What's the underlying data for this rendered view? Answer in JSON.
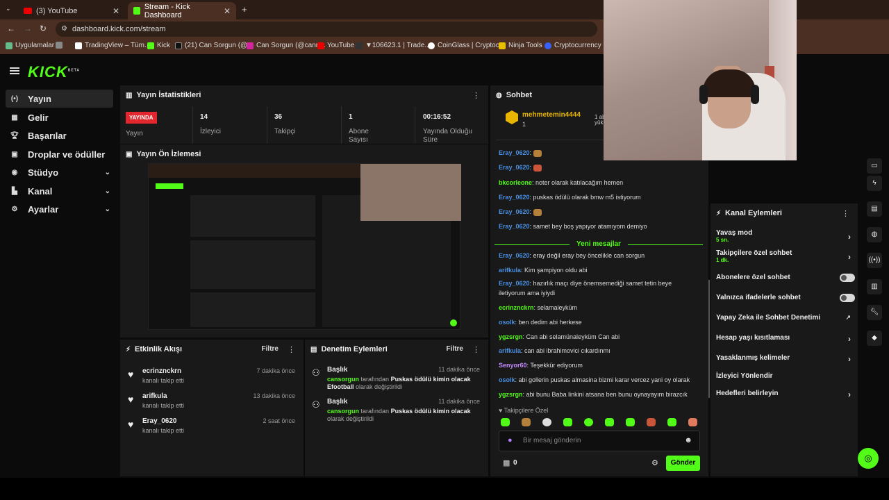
{
  "browser": {
    "tabs": [
      {
        "label": "(3) YouTube"
      },
      {
        "label": "Stream - Kick Dashboard"
      }
    ],
    "new_tab": "+",
    "url": "dashboard.kick.com/stream",
    "bookmarks": [
      "Uygulamalar",
      "TradingView – Tüm...",
      "Kick",
      "(21) Can Sorgun (@...",
      "Can Sorgun (@cann...",
      "YouTube",
      "▼106623.1 | Trade...",
      "CoinGlass | Cryptoc...",
      "Ninja Tools",
      "Cryptocurrency Pric..."
    ]
  },
  "app": {
    "logo": "KICK",
    "logo_badge": "BETA",
    "nav": [
      {
        "label": "Yayın",
        "icon": "stream-icon"
      },
      {
        "label": "Gelir",
        "icon": "revenue-icon"
      },
      {
        "label": "Başarılar",
        "icon": "trophy-icon"
      },
      {
        "label": "Droplar ve ödüller",
        "icon": "gift-icon"
      },
      {
        "label": "Stüdyo",
        "icon": "studio-icon"
      },
      {
        "label": "Kanal",
        "icon": "channel-icon"
      },
      {
        "label": "Ayarlar",
        "icon": "gear-icon"
      }
    ]
  },
  "stats": {
    "title": "Yayın İstatistikleri",
    "live_badge": "YAYINDA",
    "live_label": "Yayın",
    "items": [
      {
        "value": "14",
        "label": "İzleyici"
      },
      {
        "value": "36",
        "label": "Takipçi"
      },
      {
        "value": "1",
        "label": "Abone Sayısı"
      },
      {
        "value": "00:16:52",
        "label": "Yayında Olduğu Süre"
      }
    ]
  },
  "preview": {
    "title": "Yayın Ön İzlemesi"
  },
  "events": {
    "title": "Etkinlik Akışı",
    "filter": "Filtre",
    "items": [
      {
        "name": "ecrinznckrn",
        "sub": "kanalı takip etti",
        "time": "7 dakika önce"
      },
      {
        "name": "arifkula",
        "sub": "kanalı takip etti",
        "time": "13 dakika önce"
      },
      {
        "name": "Eray_0620",
        "sub": "kanalı takip etti",
        "time": "2 saat önce"
      }
    ]
  },
  "moderation": {
    "title": "Denetim Eylemleri",
    "filter": "Filtre",
    "items": [
      {
        "title": "Başlık",
        "time": "11 dakika önce",
        "actor": "cansorgun",
        "mid": " tarafından ",
        "target": "Puskas ödülü kimin olacak Efootball",
        "suffix": " olarak değiştirildi"
      },
      {
        "title": "Başlık",
        "time": "11 dakika önce",
        "actor": "cansorgun",
        "mid": " tarafından ",
        "target": "Puskas ödülü kimin olacak",
        "suffix": " olarak değiştirildi"
      }
    ]
  },
  "chat": {
    "title": "Sohbet",
    "pinned_user": "mehmetemin4444",
    "pinned_count": "1",
    "pinned_extra": "1 ab yük",
    "new_messages": "Yeni mesajlar",
    "messages": [
      {
        "user": "Eray_0620",
        "color": "#4a90e2",
        "text": ": "
      },
      {
        "user": "Eray_0620",
        "color": "#4a90e2",
        "text": ": "
      },
      {
        "user": "bkcorleone",
        "color": "#53fc18",
        "text": ": noter olarak katılacağım hemen"
      },
      {
        "user": "Eray_0620",
        "color": "#4a90e2",
        "text": ": puskas ödülü olarak bmw m5 istiyorum"
      },
      {
        "user": "Eray_0620",
        "color": "#4a90e2",
        "text": ": "
      },
      {
        "user": "Eray_0620",
        "color": "#4a90e2",
        "text": ": samet bey boş yapıyor atamıyom demiyo"
      },
      {
        "user": "Eray_0620",
        "color": "#4a90e2",
        "text": ": eray değil eray bey öncelikle can sorgun"
      },
      {
        "user": "arifkula",
        "color": "#4a90e2",
        "text": ": Kim şampiyon oldu abi"
      },
      {
        "user": "Eray_0620",
        "color": "#4a90e2",
        "text": ": hazırlık maçı diye önemsemediği samet tetin beye iletiyorum ama iyiydi"
      },
      {
        "user": "ecrinznckrn",
        "color": "#53fc18",
        "text": ": selamaleyküm"
      },
      {
        "user": "osolk",
        "color": "#4a90e2",
        "text": ": ben dedim abi herkese"
      },
      {
        "user": "ygzsrgn",
        "color": "#53fc18",
        "text": ": Can abi selamünaleyküm Can abi"
      },
      {
        "user": "arifkula",
        "color": "#4a90e2",
        "text": ": can abi ibrahimovici cıkardınmı"
      },
      {
        "user": "Senyor60",
        "color": "#c48bff",
        "text": ": Teşekkür ediyorum"
      },
      {
        "user": "osolk",
        "color": "#4a90e2",
        "text": ": abi gollerin puskas almasina bizmi karar vercez yani oy olarak"
      },
      {
        "user": "ygzsrgn",
        "color": "#53fc18",
        "text": ": abi bunu Baba linkini atsana ben bunu oynayayım birazcık"
      }
    ],
    "followers_only": "Takipçilere Özel",
    "input_placeholder": "Bir mesaj gönderin",
    "points": "0",
    "send": "Gönder"
  },
  "actions": {
    "title": "Kanal Eylemleri",
    "items": [
      {
        "label": "Yavaş mod",
        "sub": "5 sn.",
        "type": "chev"
      },
      {
        "label": "Takipçilere özel sohbet",
        "sub": "1 dk.",
        "type": "chev"
      },
      {
        "label": "Abonelere özel sohbet",
        "sub": "",
        "type": "toggle"
      },
      {
        "label": "Yalnızca ifadelerle sohbet",
        "sub": "",
        "type": "toggle"
      },
      {
        "label": "Yapay Zeka ile Sohbet Denetimi",
        "sub": "",
        "type": "ext"
      },
      {
        "label": "Hesap yaşı kısıtlaması",
        "sub": "",
        "type": "chev"
      },
      {
        "label": "Yasaklanmış kelimeler",
        "sub": "",
        "type": "chev"
      },
      {
        "label": "İzleyici Yönlendir",
        "sub": "",
        "type": "none"
      },
      {
        "label": "Hedefleri belirleyin",
        "sub": "",
        "type": "chev"
      }
    ]
  },
  "colors": {
    "accent": "#53fc18",
    "live": "#e2282e",
    "bg": "#0b0b0b",
    "panel": "#191919"
  }
}
